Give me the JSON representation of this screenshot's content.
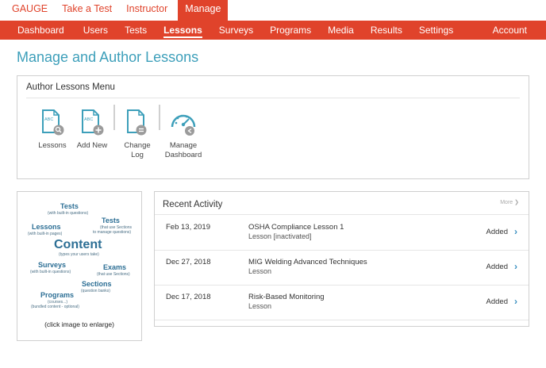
{
  "top_tabs": [
    {
      "label": "GAUGE"
    },
    {
      "label": "Take a Test"
    },
    {
      "label": "Instructor"
    },
    {
      "label": "Manage"
    }
  ],
  "sub_nav": [
    {
      "label": "Dashboard"
    },
    {
      "label": "Users"
    },
    {
      "label": "Tests"
    },
    {
      "label": "Lessons"
    },
    {
      "label": "Surveys"
    },
    {
      "label": "Programs"
    },
    {
      "label": "Media"
    },
    {
      "label": "Results"
    },
    {
      "label": "Settings"
    }
  ],
  "account_label": "Account",
  "page_title": "Manage and Author Lessons",
  "menu": {
    "title": "Author Lessons Menu",
    "lessons_label": "Lessons",
    "add_new_label": "Add New",
    "change_log_line1": "Change",
    "change_log_line2": "Log",
    "manage_dashboard_line1": "Manage",
    "manage_dashboard_line2": "Dashboard",
    "icon_text": "ABC"
  },
  "cloud": {
    "tests": "Tests",
    "tests_sub": "(with built-in questions)",
    "tests2": "Tests",
    "tests2_sub1": "(that use Sections",
    "tests2_sub2": "to manage questions)",
    "lessons": "Lessons",
    "lessons_sub": "(with built-in pages)",
    "content": "Content",
    "content_sub": "(types your users take)",
    "surveys": "Surveys",
    "surveys_sub": "(with built-in questions)",
    "exams": "Exams",
    "exams_sub": "(that use Sections)",
    "sections": "Sections",
    "sections_sub": "(question banks)",
    "programs": "Programs",
    "programs_sub1": "(courses...)",
    "programs_sub2": "(bundled content - optional)",
    "caption": "(click image to enlarge)"
  },
  "activity": {
    "title": "Recent Activity",
    "more": "More",
    "rows": [
      {
        "date": "Feb 13, 2019",
        "name": "OSHA Compliance Lesson 1",
        "sub": "Lesson [inactivated]",
        "status": "Added"
      },
      {
        "date": "Dec 27, 2018",
        "name": "MIG Welding Advanced Techniques",
        "sub": "Lesson",
        "status": "Added"
      },
      {
        "date": "Dec 17, 2018",
        "name": "Risk-Based Monitoring",
        "sub": "Lesson",
        "status": "Added"
      }
    ]
  },
  "colors": {
    "accent": "#e0432b",
    "title": "#3d9fba",
    "icon": "#3d9fba",
    "icon_badge": "#9b9b9b"
  }
}
